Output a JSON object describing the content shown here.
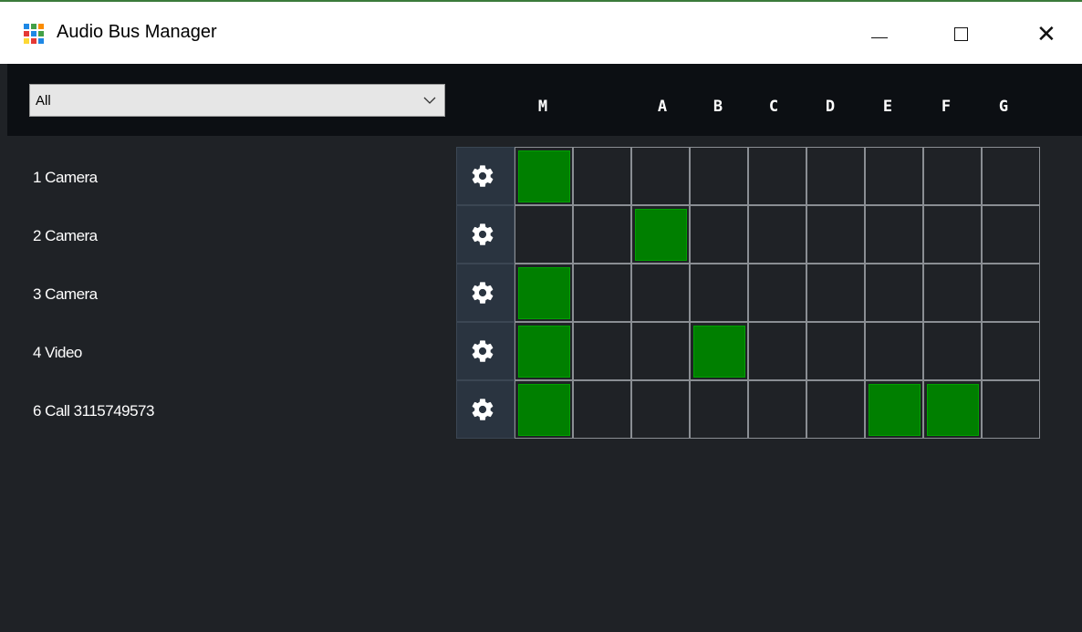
{
  "window": {
    "title": "Audio Bus Manager",
    "icon": "grid-app-icon",
    "controls": [
      "minimize-icon",
      "maximize-icon",
      "close-icon"
    ],
    "close_glyph": "✕"
  },
  "filter": {
    "selected": "All",
    "icon": "chevron-down-icon"
  },
  "buses": [
    "M",
    "A",
    "B",
    "C",
    "D",
    "E",
    "F",
    "G"
  ],
  "inputs": [
    {
      "label": "1 Camera",
      "active": [
        true,
        false,
        false,
        false,
        false,
        false,
        false,
        false,
        false
      ]
    },
    {
      "label": "2 Camera",
      "active": [
        false,
        false,
        true,
        false,
        false,
        false,
        false,
        false,
        false
      ]
    },
    {
      "label": "3 Camera",
      "active": [
        true,
        false,
        false,
        false,
        false,
        false,
        false,
        false,
        false
      ]
    },
    {
      "label": "4 Video",
      "active": [
        true,
        false,
        false,
        true,
        false,
        false,
        false,
        false,
        false
      ]
    },
    {
      "label": "6 Call 3115749573",
      "active": [
        true,
        false,
        false,
        false,
        false,
        false,
        true,
        true,
        false
      ]
    }
  ],
  "colors": {
    "active": "#007f00",
    "background": "#1f2226",
    "header": "#0c0f13",
    "settings_button": "#2a3440"
  }
}
